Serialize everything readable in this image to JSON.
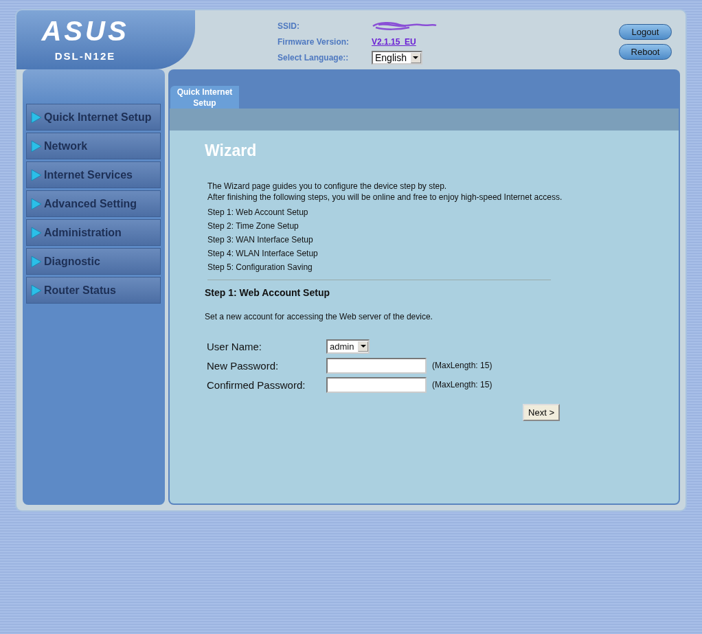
{
  "header": {
    "logo": "ASUS",
    "model": "DSL-N12E",
    "ssid_label": "SSID:",
    "firmware_label": "Firmware Version:",
    "firmware_version": "V2.1.15_EU",
    "language_label": "Select Language::",
    "language": "English"
  },
  "header_buttons": [
    "Logout",
    "Reboot"
  ],
  "sidebar": {
    "items": [
      "Quick Internet Setup",
      "Network",
      "Internet Services",
      "Advanced Setting",
      "Administration",
      "Diagnostic",
      "Router Status"
    ]
  },
  "tabs": [
    {
      "label": "Quick Internet Setup",
      "selected": true
    }
  ],
  "content": {
    "title": "Wizard",
    "intro": "The Wizard page guides you to configure the device step by step.\nAfter finishing the following steps, you will be online and free to enjoy high-speed Internet access.",
    "steps": [
      "Step 1: Web Account Setup",
      "Step 2: Time Zone Setup",
      "Step 3: WAN Interface Setup",
      "Step 4: WLAN Interface Setup",
      "Step 5: Configuration Saving"
    ],
    "section_title": "Step 1: Web Account Setup",
    "section_description": "Set a new account for accessing the Web server of the device.",
    "form": [
      {
        "kind": "select",
        "label": "User Name:",
        "value": "admin"
      },
      {
        "kind": "password",
        "label": "New Password:",
        "hint": "(MaxLength: 15)"
      },
      {
        "kind": "password",
        "label": "Confirmed Password:",
        "hint": "(MaxLength: 15)"
      }
    ],
    "next_button": "Next >"
  }
}
